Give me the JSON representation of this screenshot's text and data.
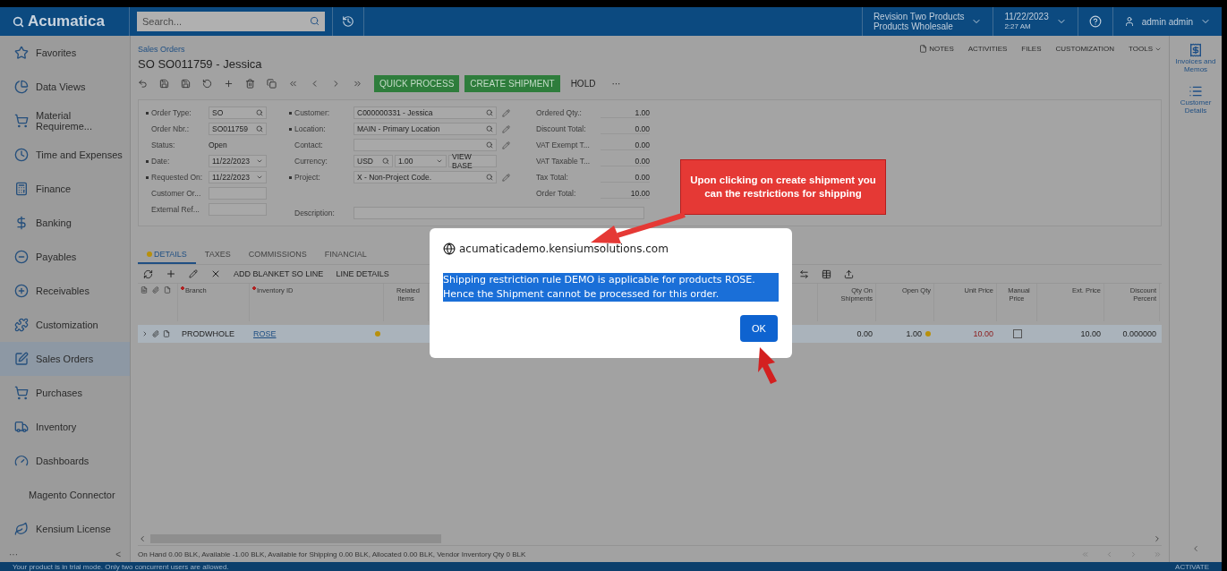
{
  "header": {
    "logo": "Acumatica",
    "search": {
      "placeholder": "Search..."
    },
    "company": {
      "line1": "Revision Two Products",
      "line2": "Products Wholesale"
    },
    "date": {
      "date": "11/22/2023",
      "time": "2:27 AM"
    },
    "user": "admin admin"
  },
  "sidebar": {
    "items": [
      {
        "label": "Favorites",
        "selected": false
      },
      {
        "label": "Data Views",
        "selected": false
      },
      {
        "label": "Material Requireme...",
        "selected": false
      },
      {
        "label": "Time and Expenses",
        "selected": false
      },
      {
        "label": "Finance",
        "selected": false
      },
      {
        "label": "Banking",
        "selected": false
      },
      {
        "label": "Payables",
        "selected": false
      },
      {
        "label": "Receivables",
        "selected": false
      },
      {
        "label": "Customization",
        "selected": false
      },
      {
        "label": "Sales Orders",
        "selected": true
      },
      {
        "label": "Purchases",
        "selected": false
      },
      {
        "label": "Inventory",
        "selected": false
      },
      {
        "label": "Dashboards",
        "selected": false
      },
      {
        "label": "Magento Connector",
        "selected": false
      },
      {
        "label": "Kensium License",
        "selected": false
      }
    ],
    "more": "···",
    "collapse": "<"
  },
  "page": {
    "breadcrumb": "Sales Orders",
    "title": "SO SO011759 - Jessica",
    "actions": [
      {
        "label": "QUICK PROCESS",
        "kind": "primary"
      },
      {
        "label": "CREATE SHIPMENT",
        "kind": "primary"
      },
      {
        "label": "HOLD",
        "kind": "plain"
      },
      {
        "label": "···",
        "kind": "plain"
      }
    ],
    "links": [
      "NOTES",
      "ACTIVITIES",
      "FILES",
      "CUSTOMIZATION",
      "TOOLS"
    ]
  },
  "right_panel": {
    "items": [
      "Invoices and Memos",
      "Customer Details"
    ]
  },
  "form": {
    "columns": [
      [
        {
          "label": "Order Type:",
          "value": "SO",
          "kind": "lookup",
          "required": true
        },
        {
          "label": "Order Nbr.:",
          "value": "SO011759",
          "kind": "lookup",
          "required": false
        },
        {
          "label": "Status:",
          "value": "Open",
          "kind": "text",
          "required": false
        },
        {
          "label": "Date:",
          "value": "11/22/2023",
          "kind": "date",
          "required": true
        },
        {
          "label": "Requested On:",
          "value": "11/22/2023",
          "kind": "date",
          "required": true
        },
        {
          "label": "Customer Or...",
          "kind": "input",
          "required": false
        },
        {
          "label": "External Ref...",
          "kind": "input",
          "required": false
        }
      ],
      [
        {
          "label": "Customer:",
          "value": "C000000331 - Jessica",
          "kind": "lookup-edit",
          "required": true
        },
        {
          "label": "Location:",
          "value": "MAIN - Primary Location",
          "kind": "lookup-edit",
          "required": true
        },
        {
          "label": "Contact:",
          "kind": "lookup-edit",
          "required": false
        },
        {
          "label": "Currency:",
          "value": "USD",
          "rate": "1.00",
          "button": "VIEW BASE",
          "kind": "currency",
          "required": false
        },
        {
          "label": "Project:",
          "value": "X - Non-Project Code.",
          "kind": "lookup-edit",
          "required": true
        },
        {
          "label": "Description:",
          "kind": "wide",
          "required": false
        }
      ],
      [
        {
          "label": "Ordered Qty.:",
          "value": "1.00",
          "kind": "total",
          "required": false
        },
        {
          "label": "Discount Total:",
          "value": "0.00",
          "kind": "total",
          "required": false
        },
        {
          "label": "VAT Exempt T...",
          "value": "0.00",
          "kind": "total",
          "required": false
        },
        {
          "label": "VAT Taxable T...",
          "value": "0.00",
          "kind": "total",
          "required": false
        },
        {
          "label": "Tax Total:",
          "value": "0.00",
          "kind": "total",
          "required": false
        },
        {
          "label": "Order Total:",
          "value": "10.00",
          "kind": "total",
          "required": false
        }
      ]
    ]
  },
  "tabs": [
    {
      "label": "DETAILS",
      "selected": true,
      "warning": true
    },
    {
      "label": "TAXES",
      "selected": false,
      "warning": false
    },
    {
      "label": "COMMISSIONS",
      "selected": false,
      "warning": false
    },
    {
      "label": "FINANCIAL",
      "selected": false,
      "warning": false
    }
  ],
  "grid_toolbar": [
    "ADD BLANKET SO LINE",
    "LINE DETAILS"
  ],
  "table": {
    "columns": [
      {
        "label": "Branch",
        "required": true
      },
      {
        "label": "Inventory ID",
        "required": true
      },
      {
        "label": "Related Items",
        "required": false
      },
      {
        "label": "Qty On Shipments",
        "required": false
      },
      {
        "label": "Open Qty",
        "required": false
      },
      {
        "label": "Unit Price",
        "required": false
      },
      {
        "label": "Manual Price",
        "required": false
      },
      {
        "label": "Ext. Price",
        "required": false
      },
      {
        "label": "Discount Percent",
        "required": false
      }
    ],
    "rows": [
      {
        "selected": true,
        "branch": "PRODWHOLE",
        "inventory_id": "ROSE",
        "qty_on_shipments": "0.00",
        "open_qty": "1.00",
        "unit_price": "10.00",
        "manual_price": false,
        "ext_price": "10.00",
        "discount_percent": "0.000000"
      }
    ]
  },
  "summary": "On Hand 0.00 BLK, Available -1.00 BLK, Available for Shipping 0.00 BLK, Allocated 0.00 BLK, Vendor Inventory Qty 0 BLK",
  "trial_bar": {
    "message": "Your product is in trial mode. Only two concurrent users are allowed.",
    "action": "ACTIVATE"
  },
  "dialog": {
    "origin": "acumaticademo.kensiumsolutions.com",
    "message": "Shipping restriction rule DEMO is applicable for products ROSE. Hence the Shipment cannot be processed for this order.",
    "button": "OK"
  },
  "callout": {
    "text": "Upon clicking on create shipment you can the restrictions for shipping"
  }
}
